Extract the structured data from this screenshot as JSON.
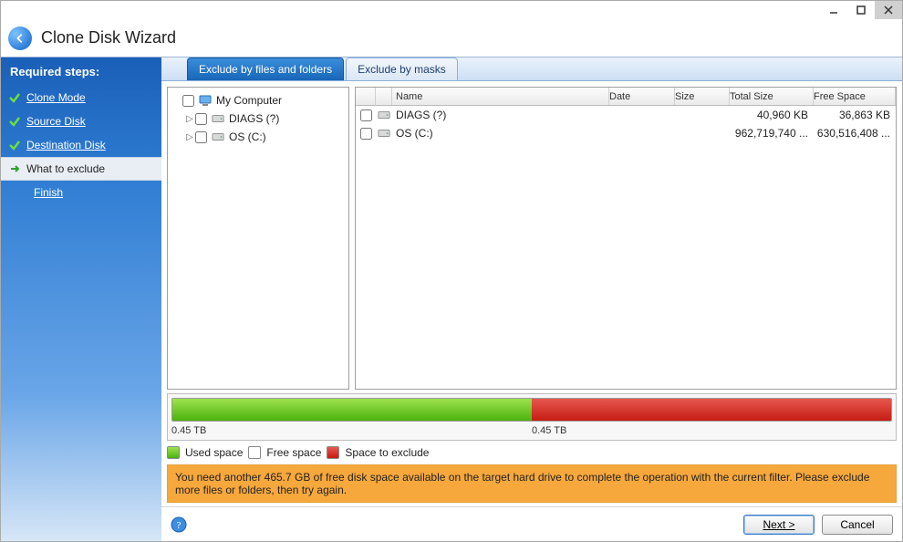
{
  "title": "Clone Disk Wizard",
  "sidebar": {
    "header": "Required steps:",
    "steps": [
      {
        "label": "Clone Mode",
        "state": "done"
      },
      {
        "label": "Source Disk",
        "state": "done"
      },
      {
        "label": "Destination Disk",
        "state": "done"
      },
      {
        "label": "What to exclude",
        "state": "active"
      },
      {
        "label": "Finish",
        "state": "future"
      }
    ]
  },
  "tabs": {
    "t1": "Exclude by files and folders",
    "t2": "Exclude by masks"
  },
  "tree": {
    "root": "My Computer",
    "children": [
      {
        "label": "DIAGS (?)"
      },
      {
        "label": "OS (C:)"
      }
    ]
  },
  "list": {
    "headers": {
      "name": "Name",
      "date": "Date",
      "size": "Size",
      "total": "Total Size",
      "free": "Free Space"
    },
    "rows": [
      {
        "name": "DIAGS (?)",
        "date": "",
        "size": "",
        "total": "40,960 KB",
        "free": "36,863 KB"
      },
      {
        "name": "OS (C:)",
        "date": "",
        "size": "",
        "total": "962,719,740 ...",
        "free": "630,516,408 ..."
      }
    ]
  },
  "progress": {
    "used_label": "0.45 TB",
    "exclude_label": "0.45 TB",
    "used_pct": 50,
    "exclude_pct": 50
  },
  "legend": {
    "used": "Used space",
    "free": "Free space",
    "exclude": "Space to exclude"
  },
  "warning": "You need another 465.7 GB of free disk space available on the target hard drive to complete the operation with the current filter. Please exclude more files or folders, then try again.",
  "buttons": {
    "next": "Next >",
    "cancel": "Cancel"
  }
}
